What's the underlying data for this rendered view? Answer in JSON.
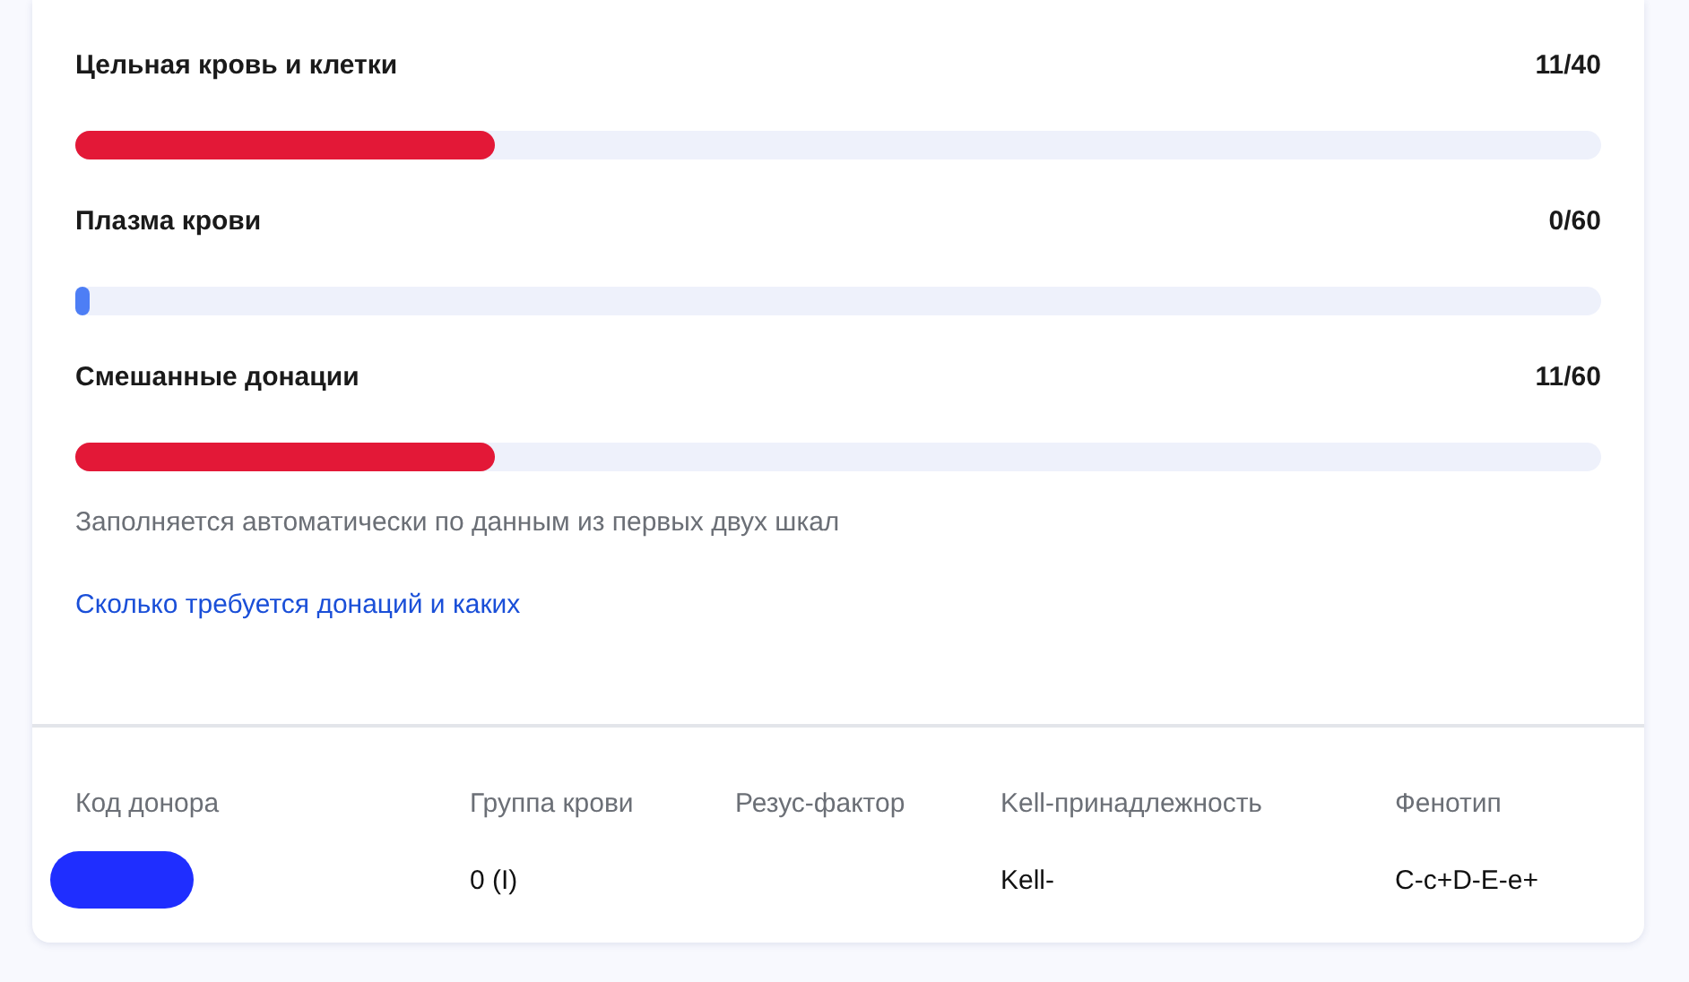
{
  "scales": [
    {
      "title": "Цельная кровь и клетки",
      "count": "11/40",
      "level": 0.275,
      "color": "#e31837"
    },
    {
      "title": "Плазма крови",
      "count": "0/60",
      "level": 0,
      "color": "#4d7ef5"
    },
    {
      "title": "Смешанные донации",
      "count": "11/60",
      "level": 0.275,
      "color": "#e31837"
    }
  ],
  "note": "Заполняется автоматически по данным из первых двух шкал",
  "link": "Сколько требуется донаций и каких",
  "donor_table": {
    "columns": [
      "Код донора",
      "Группа крови",
      "Резус-фактор",
      "Kell-принадлежность",
      "Фенотип"
    ],
    "row": [
      {
        "kind": "redacted"
      },
      {
        "kind": "text",
        "text": "0 (I)"
      },
      {
        "kind": "empty"
      },
      {
        "kind": "text",
        "text": "Kell-"
      },
      {
        "kind": "text",
        "text": "C-c+D-E-e+"
      }
    ]
  }
}
